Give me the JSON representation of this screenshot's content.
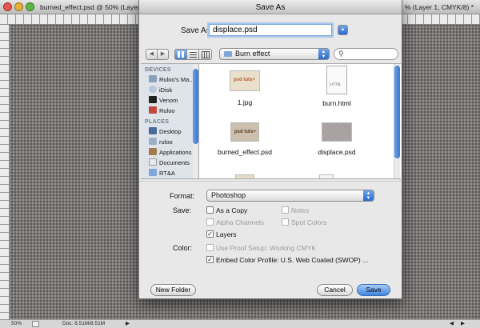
{
  "photoshop": {
    "doc_title": "burned_effect.psd @ 50% (Layer 1 copy 4, CM...",
    "doc_title_right": "% (Layer 1, CMYK/8) *",
    "zoom": "50%",
    "doc_size": "Doc: 8.51M/8.51M",
    "colors": {
      "canvas": "#7b7676"
    }
  },
  "dialog": {
    "title": "Save As",
    "save_as_label": "Save As:",
    "filename": "displace.psd",
    "location": "Burn effect",
    "sidebar": {
      "devices_header": "DEVICES",
      "devices": [
        {
          "label": "Ruloo's Ma...",
          "icon": "computer-icon"
        },
        {
          "label": "iDisk",
          "icon": "idisk-icon"
        },
        {
          "label": "Venom",
          "icon": "drive-icon"
        },
        {
          "label": "Ruloo",
          "icon": "drive-icon"
        }
      ],
      "places_header": "PLACES",
      "places": [
        {
          "label": "Desktop",
          "icon": "desktop-icon"
        },
        {
          "label": "ruloo",
          "icon": "home-icon"
        },
        {
          "label": "Applications",
          "icon": "applications-icon"
        },
        {
          "label": "Documents",
          "icon": "documents-icon"
        },
        {
          "label": "RT&A",
          "icon": "folder-icon"
        }
      ]
    },
    "files": [
      {
        "name": "1.jpg"
      },
      {
        "name": "burn.html",
        "badge": "HTML"
      },
      {
        "name": "burned_effect.psd"
      },
      {
        "name": "displace.psd"
      }
    ],
    "thumb_text": "psd tuts+",
    "format_label": "Format:",
    "format_value": "Photoshop",
    "save_label": "Save:",
    "color_label": "Color:",
    "options": {
      "as_copy": "As a Copy",
      "notes": "Notes",
      "alpha": "Alpha Channels",
      "spot": "Spot Colors",
      "layers": "Layers",
      "proof": "Use Proof Setup:  Working CMYK",
      "embed": "Embed Color Profile:  U.S. Web Coated (SWOP) ..."
    },
    "buttons": {
      "new_folder": "New Folder",
      "cancel": "Cancel",
      "save": "Save"
    },
    "colors": {
      "accent": "#3f84df",
      "panel": "#e8e8e8"
    }
  }
}
